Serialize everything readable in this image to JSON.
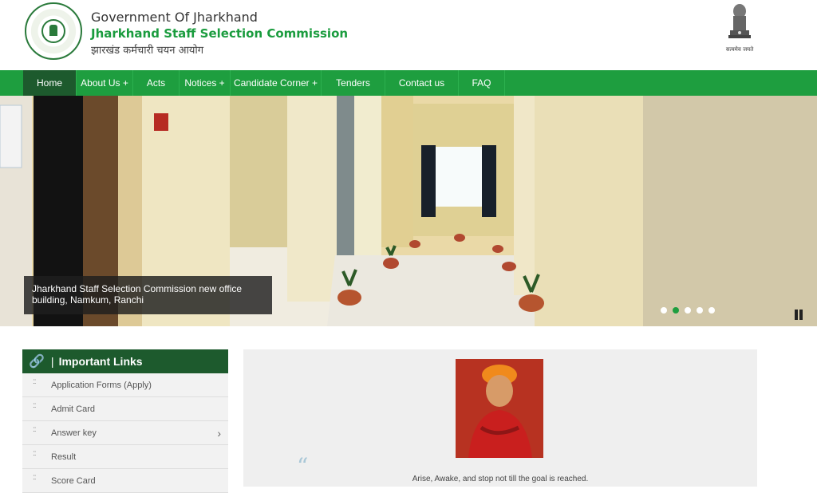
{
  "header": {
    "gov_title": "Government Of Jharkhand",
    "org_title": "Jharkhand Staff Selection Commission",
    "hindi_title": "झारखंड कर्मचारी चयन आयोग",
    "emblem_text": "सत्यमेव जयते"
  },
  "nav": {
    "items": [
      {
        "label": "Home"
      },
      {
        "label": "About Us +"
      },
      {
        "label": "Acts"
      },
      {
        "label": "Notices +"
      },
      {
        "label": "Candidate Corner +"
      },
      {
        "label": "Tenders"
      },
      {
        "label": "Contact us"
      },
      {
        "label": "FAQ"
      }
    ]
  },
  "banner": {
    "caption": "Jharkhand Staff Selection Commission new office building, Namkum, Ranchi",
    "dots_count": 5,
    "active_dot": 2
  },
  "important_links": {
    "title": "Important Links",
    "items": [
      {
        "label": "Application Forms (Apply)"
      },
      {
        "label": "Admit Card"
      },
      {
        "label": "Answer key"
      },
      {
        "label": "Result"
      },
      {
        "label": "Score Card"
      }
    ]
  },
  "quote": {
    "mark": "“",
    "text": "Arise, Awake, and stop not till the goal is reached."
  },
  "colors": {
    "nav_green": "#1e9e3f",
    "dark_green": "#1d5a2d",
    "brand_text_green": "#1a9c3e"
  }
}
